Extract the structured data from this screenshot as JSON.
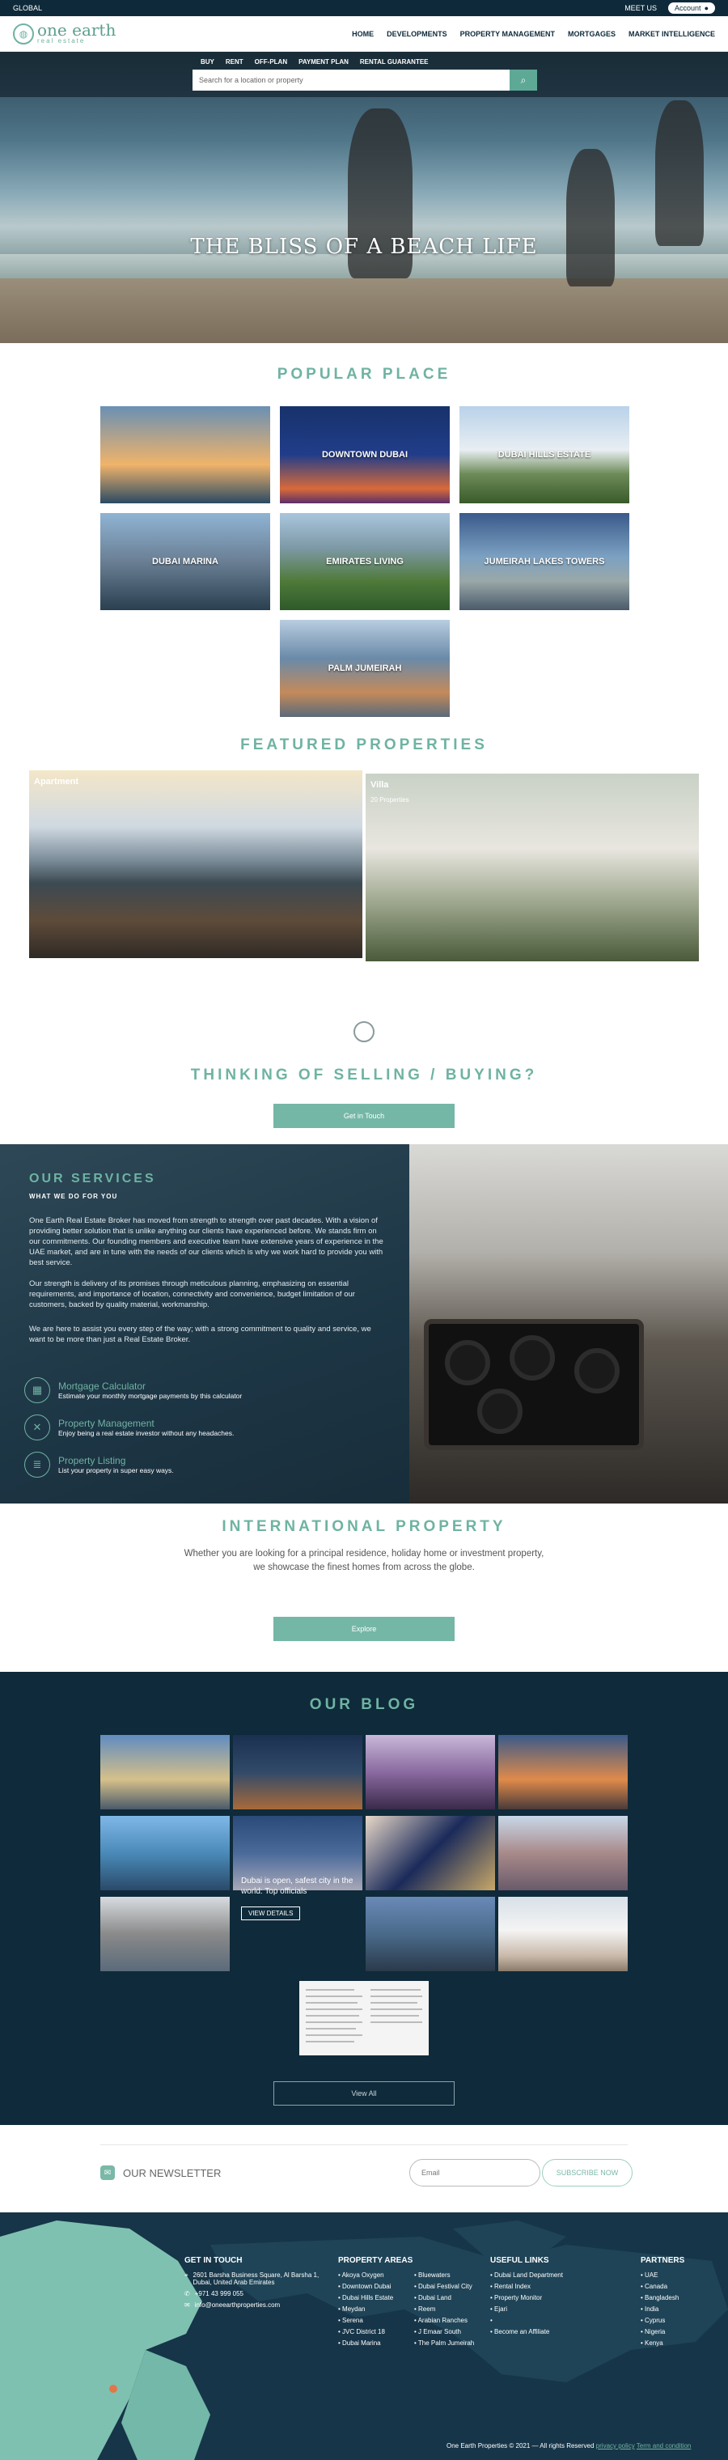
{
  "topbar": {
    "region": "GLOBAL",
    "meet_us": "MEET US",
    "account": "Account"
  },
  "logo": {
    "name": "one earth",
    "tagline": "real estate"
  },
  "nav": [
    "HOME",
    "DEVELOPMENTS",
    "PROPERTY MANAGEMENT",
    "MORTGAGES",
    "MARKET INTELLIGENCE"
  ],
  "hero": {
    "tabs": [
      "BUY",
      "RENT",
      "OFF-PLAN",
      "PAYMENT PLAN",
      "RENTAL GUARANTEE"
    ],
    "search_placeholder": "Search for a location or property",
    "title": "THE BLISS OF A BEACH LIFE"
  },
  "popular": {
    "title": "POPULAR PLACE",
    "places": [
      "",
      "DOWNTOWN DUBAI",
      "DUBAI HILLS ESTATE",
      "DUBAI MARINA",
      "EMIRATES LIVING",
      "JUMEIRAH LAKES TOWERS",
      "PALM JUMEIRAH"
    ]
  },
  "featured": {
    "title": "FEATURED PROPERTIES",
    "cards": [
      {
        "label": "Apartment",
        "count": ""
      },
      {
        "label": "Villa",
        "count": "20 Properties"
      }
    ]
  },
  "thinking": {
    "title": "THINKING OF SELLING / BUYING?",
    "button": "Get in Touch"
  },
  "services": {
    "title": "OUR SERVICES",
    "subtitle": "WHAT WE DO FOR YOU",
    "paragraphs": [
      "One Earth Real Estate Broker has moved from strength to strength over past decades. With a vision of providing better solution that is unlike anything our clients have experienced before. We stands firm on our commitments. Our founding members and executive team have extensive years of experience in the UAE market, and are in tune with the needs of our clients which is why we work hard to provide you with best service.",
      "Our strength is delivery of its promises through meticulous planning, emphasizing on essential requirements, and importance of location, connectivity and convenience, budget limitation of our customers, backed by quality material, workmanship.",
      "We are here to assist you every step of the way; with a strong commitment to quality and service, we want to be more than just a Real Estate Broker."
    ],
    "items": [
      {
        "icon": "calculator-icon",
        "title": "Mortgage Calculator",
        "desc": "Estimate your monthly mortgage payments by this calculator"
      },
      {
        "icon": "tools-icon",
        "title": "Property Management",
        "desc": "Enjoy being a real estate investor without any headaches."
      },
      {
        "icon": "listing-icon",
        "title": "Property Listing",
        "desc": "List your property in super easy ways."
      }
    ]
  },
  "international": {
    "title": "INTERNATIONAL PROPERTY",
    "text_line1": "Whether you are looking for a principal residence, holiday home or investment property,",
    "text_line2": "we showcase the finest homes from across the globe.",
    "button": "Explore"
  },
  "blog": {
    "title": "OUR BLOG",
    "featured_caption": "Dubai is open, safest city in the world: Top officials",
    "details_button": "VIEW DETAILS",
    "view_all": "View All"
  },
  "newsletter": {
    "label": "OUR NEWSLETTER",
    "email_placeholder": "Email",
    "subscribe": "SUBSCRIBE NOW"
  },
  "footer": {
    "get_in_touch": {
      "title": "GET IN TOUCH",
      "address": "2601 Barsha Business Square, Al Barsha 1, Dubai, United Arab Emirates",
      "phone": "+971 43 999 055",
      "email": "info@oneearthproperties.com"
    },
    "property_areas": {
      "title": "PROPERTY AREAS",
      "col1": [
        "Akoya Oxygen",
        "Downtown Dubai",
        "Dubai Hills Estate",
        "Meydan",
        "Serena",
        "JVC District 18",
        "Dubai Marina"
      ],
      "col2": [
        "Bluewaters",
        "Dubai Festival City",
        "Dubai Land",
        "Reem",
        "Arabian Ranches",
        "J Emaar South",
        "The Palm Jumeirah"
      ]
    },
    "useful_links": {
      "title": "USEFUL LINKS",
      "items": [
        "Dubai Land Department",
        "Rental Index",
        "Property Monitor",
        "Ejari",
        "",
        "Become an Affiliate"
      ]
    },
    "partners": {
      "title": "PARTNERS",
      "items": [
        "UAE",
        "Canada",
        "Bangladesh",
        "India",
        "Cyprus",
        "Nigeria",
        "Kenya"
      ]
    },
    "copyright": "One Earth Properties © 2021 — All rights Reserved",
    "privacy": "privacy policy",
    "terms": "Term and condition"
  },
  "colors": {
    "accent": "#6fb3a2",
    "navy": "#0f2a3a"
  }
}
